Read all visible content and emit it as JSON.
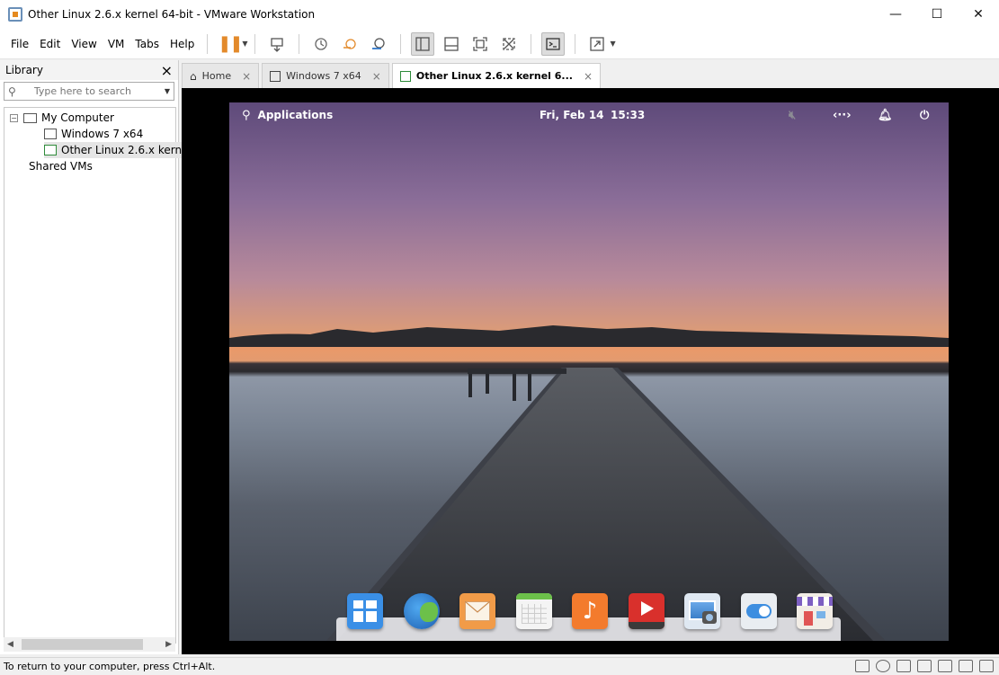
{
  "window": {
    "title": "Other Linux 2.6.x kernel 64-bit - VMware Workstation",
    "minimize": "—",
    "maximize": "☐",
    "close": "✕"
  },
  "menu": [
    "File",
    "Edit",
    "View",
    "VM",
    "Tabs",
    "Help"
  ],
  "toolbar": {
    "icons": [
      "pause-icon",
      "send-ctrl-alt-del-icon",
      "snapshot-icon",
      "revert-snapshot-icon",
      "snapshot-manager-icon",
      "library-view-icon",
      "thumbnail-bar-icon",
      "full-screen-icon",
      "unity-icon",
      "console-icon",
      "stretch-icon"
    ]
  },
  "library": {
    "title": "Library",
    "close": "×",
    "search_placeholder": "Type here to search",
    "tree": {
      "root": "My Computer",
      "children": [
        "Windows 7 x64",
        "Other Linux 2.6.x kernel"
      ],
      "shared": "Shared VMs"
    }
  },
  "tabs": [
    {
      "label": "Home",
      "close": "×"
    },
    {
      "label": "Windows 7 x64",
      "close": "×"
    },
    {
      "label": "Other Linux 2.6.x kernel 6...",
      "close": "×"
    }
  ],
  "guest": {
    "panel": {
      "applications": "Applications",
      "date": "Fri, Feb 14",
      "time": "15:33"
    },
    "dock_apps": [
      "multitasking-view",
      "web-browser",
      "mail",
      "calendar",
      "music",
      "videos",
      "photos",
      "system-settings",
      "app-center"
    ]
  },
  "statusbar": {
    "text": "To return to your computer, press Ctrl+Alt."
  },
  "colors": {
    "accent": "#e38a2b",
    "vm_bg": "#000000"
  }
}
